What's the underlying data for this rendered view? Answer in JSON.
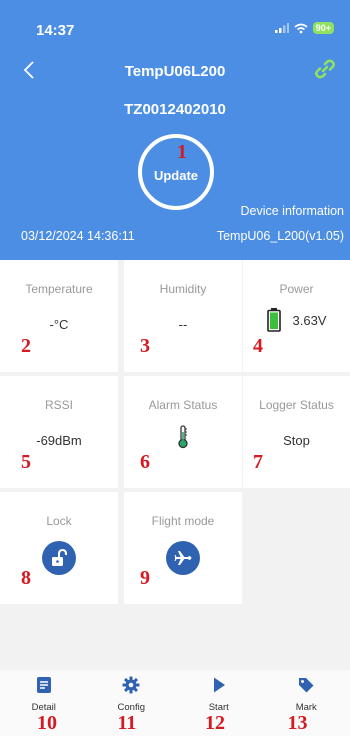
{
  "status_bar": {
    "time": "14:37",
    "battery": "90+"
  },
  "header": {
    "device_name": "TempU06L200",
    "serial": "TZ0012402010",
    "update_label": "Update",
    "device_info_label": "Device information",
    "timestamp": "03/12/2024 14:36:11",
    "firmware": "TempU06_L200(v1.05)"
  },
  "tiles": {
    "temperature": {
      "title": "Temperature",
      "value": "-°C"
    },
    "humidity": {
      "title": "Humidity",
      "value": "--"
    },
    "power": {
      "title": "Power",
      "value": "3.63V",
      "icon": "battery-icon"
    },
    "rssi": {
      "title": "RSSI",
      "value": "-69dBm"
    },
    "alarm_status": {
      "title": "Alarm Status",
      "icon": "thermometer-icon"
    },
    "logger_status": {
      "title": "Logger Status",
      "value": "Stop"
    },
    "lock": {
      "title": "Lock",
      "icon": "unlock-icon"
    },
    "flight_mode": {
      "title": "Flight mode",
      "icon": "airplane-icon"
    }
  },
  "nav": [
    {
      "label": "Detail",
      "icon": "document-icon"
    },
    {
      "label": "Config",
      "icon": "gear-icon"
    },
    {
      "label": "Start",
      "icon": "play-icon"
    },
    {
      "label": "Mark",
      "icon": "tag-icon"
    }
  ],
  "markers": [
    "1",
    "2",
    "3",
    "4",
    "5",
    "6",
    "7",
    "8",
    "9",
    "10",
    "11",
    "12",
    "13"
  ],
  "colors": {
    "header": "#4c8ee3",
    "accent": "#2f62b0",
    "link": "#8fe25f",
    "marker": "#d71921"
  }
}
